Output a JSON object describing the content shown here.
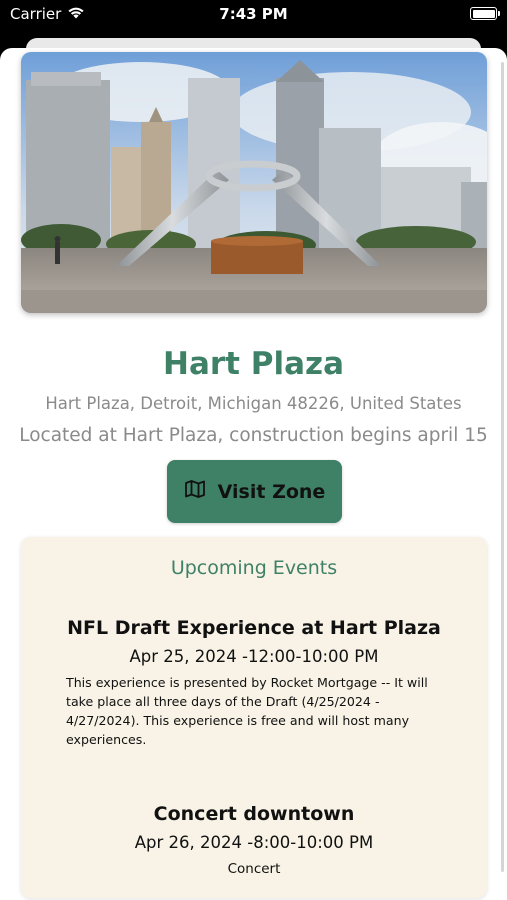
{
  "status_bar": {
    "carrier": "Carrier",
    "time": "7:43 PM",
    "icons": [
      "wifi-icon",
      "battery-icon"
    ]
  },
  "place": {
    "title": "Hart Plaza",
    "address": "Hart Plaza, Detroit, Michigan 48226, United States",
    "note": "Located at Hart Plaza, construction begins april 15",
    "visit_button": {
      "label": "Visit Zone",
      "icon": "map-icon"
    }
  },
  "events": {
    "heading": "Upcoming Events",
    "items": [
      {
        "title": "NFL Draft Experience at Hart Plaza",
        "when": "Apr 25, 2024 -12:00-10:00 PM",
        "description": "This experience is presented by Rocket Mortgage -- It will take place all three days of the Draft (4/25/2024 - 4/27/2024). This experience is free and will host many experiences."
      },
      {
        "title": "Concert downtown",
        "when": "Apr 26, 2024 -8:00-10:00 PM",
        "description": "Concert"
      }
    ]
  },
  "colors": {
    "accent": "#3f8167",
    "card_background": "#f8f3e6",
    "secondary_text": "#8a8a8a"
  }
}
